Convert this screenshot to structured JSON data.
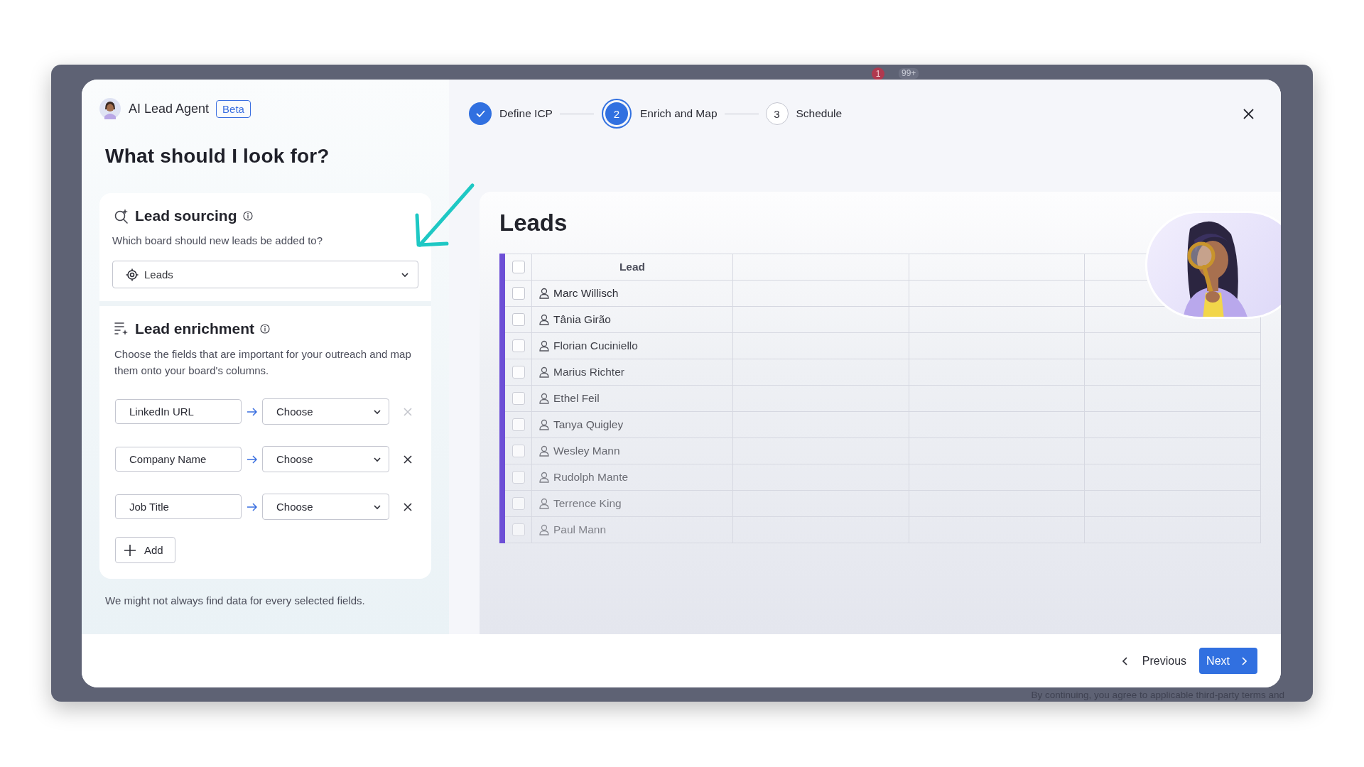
{
  "backdrop": {
    "badges": [
      "1",
      "99+"
    ],
    "footnote": "By continuing, you agree to applicable third-party terms and"
  },
  "agent": {
    "name": "AI Lead Agent",
    "badge": "Beta"
  },
  "title": "What should I look for?",
  "sourcing": {
    "heading": "Lead sourcing",
    "question": "Which board should new leads be added to?",
    "board": "Leads"
  },
  "enrichment": {
    "heading": "Lead enrichment",
    "description": "Choose the fields that are important for your outreach and map them onto your board's columns.",
    "mappings": [
      {
        "field": "LinkedIn URL",
        "target": "Choose",
        "disabled": true
      },
      {
        "field": "Company Name",
        "target": "Choose",
        "disabled": false
      },
      {
        "field": "Job Title",
        "target": "Choose",
        "disabled": false
      }
    ],
    "add_label": "Add"
  },
  "note": "We might not always find data for every selected fields.",
  "steps": [
    {
      "label": "Define ICP",
      "completed": true,
      "selected": false
    },
    {
      "number": "2",
      "label": "Enrich and Map",
      "completed": false,
      "selected": true
    },
    {
      "number": "3",
      "label": "Schedule",
      "completed": false,
      "selected": false
    }
  ],
  "board": {
    "title": "Leads",
    "columns": [
      "Lead"
    ],
    "select_all": {
      "checked": false
    },
    "rows": [
      {
        "name": "Marc Willisch",
        "checked": false
      },
      {
        "name": "Tânia Girão",
        "checked": false
      },
      {
        "name": "Florian Cuciniello",
        "checked": false
      },
      {
        "name": "Marius Richter",
        "checked": false
      },
      {
        "name": "Ethel Feil",
        "checked": false
      },
      {
        "name": "Tanya Quigley",
        "checked": false
      },
      {
        "name": "Wesley Mann",
        "checked": false
      },
      {
        "name": "Rudolph Mante",
        "checked": false
      },
      {
        "name": "Terrence King",
        "checked": false
      },
      {
        "name": "Paul Mann",
        "checked": false
      }
    ]
  },
  "footer": {
    "previous": "Previous",
    "next": "Next"
  }
}
